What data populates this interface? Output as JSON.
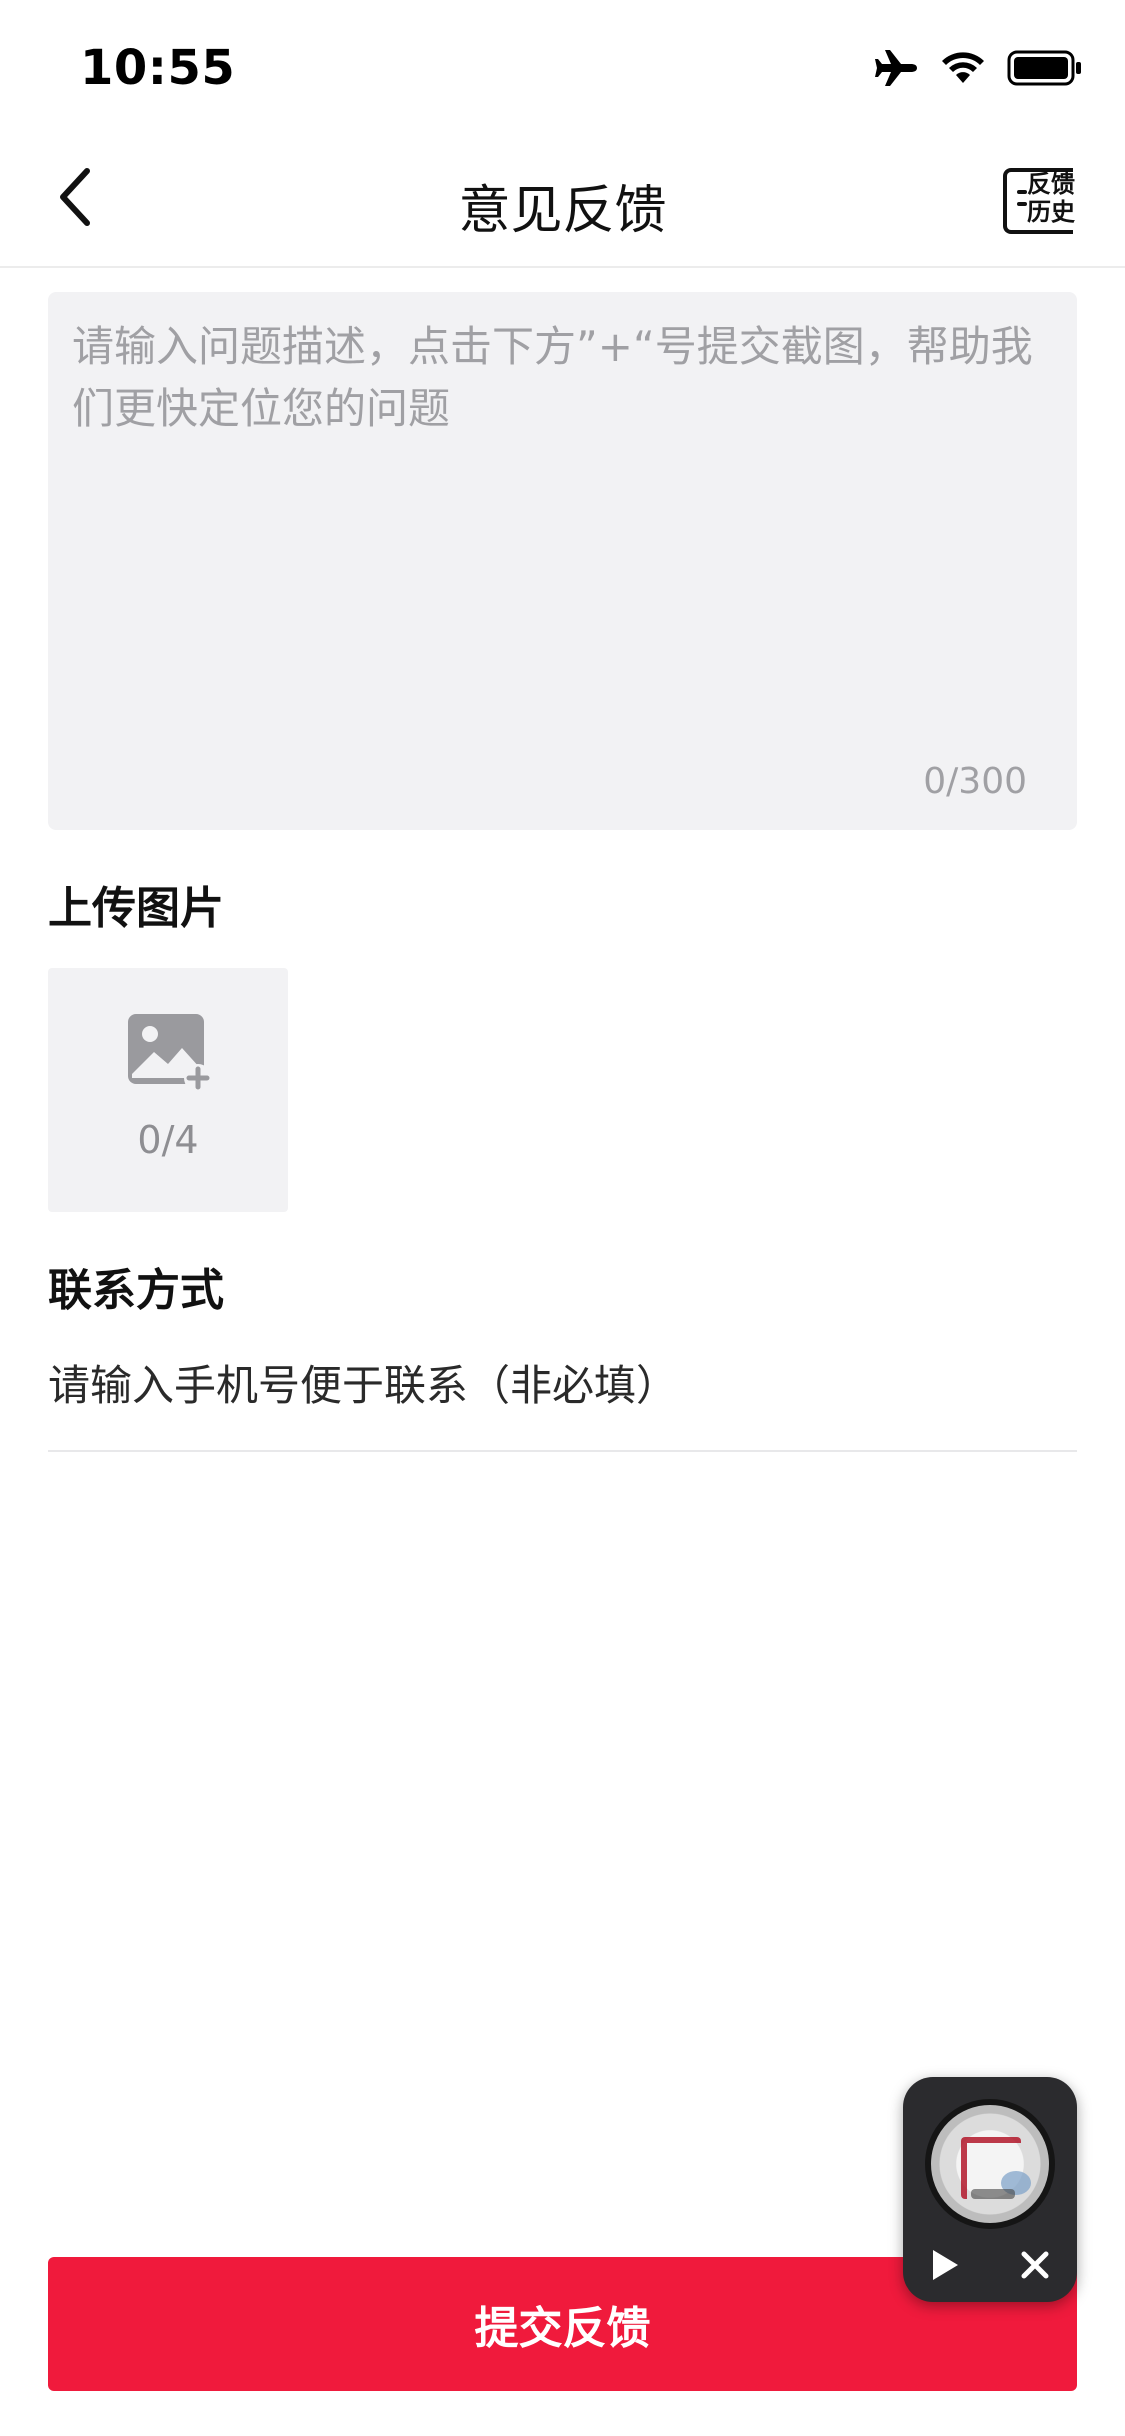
{
  "status_bar": {
    "time": "10:55",
    "icons": [
      "airplane-icon",
      "wifi-icon",
      "battery-icon"
    ]
  },
  "nav": {
    "title": "意见反馈",
    "back_icon": "chevron-left-icon",
    "history_label": "反馈历史",
    "history_icon": "feedback-history-icon"
  },
  "description": {
    "placeholder": "请输入问题描述，点击下方”+“号提交截图，帮助我们更快定位您的问题",
    "value": "",
    "counter": "0/300"
  },
  "upload": {
    "title": "上传图片",
    "icon": "add-image-icon",
    "count": "0/4"
  },
  "contact": {
    "title": "联系方式",
    "placeholder": "请输入手机号便于联系（非必填）",
    "value": ""
  },
  "submit": {
    "label": "提交反馈"
  },
  "mini_player": {
    "play_icon": "play-icon",
    "close_icon": "close-icon"
  },
  "colors": {
    "accent": "#f01a3c",
    "field_background": "#f2f2f4",
    "placeholder_text": "#a0a0a4"
  }
}
